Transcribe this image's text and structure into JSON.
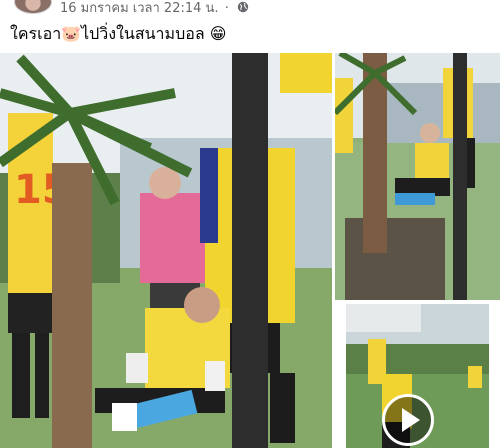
{
  "post": {
    "date": "16 มกราคม เวลา 22:14 น.",
    "separator": "·",
    "privacy_icon": "globe-icon",
    "caption": "ใครเอา🐷ไปวิ่งในสนามบอล 😁"
  },
  "photos": [
    {
      "name": "photo-main",
      "kind": "image"
    },
    {
      "name": "photo-top-right",
      "kind": "image"
    },
    {
      "name": "photo-bottom-right",
      "kind": "video",
      "overlay_icon": "play-icon"
    }
  ],
  "jersey_number": "15"
}
